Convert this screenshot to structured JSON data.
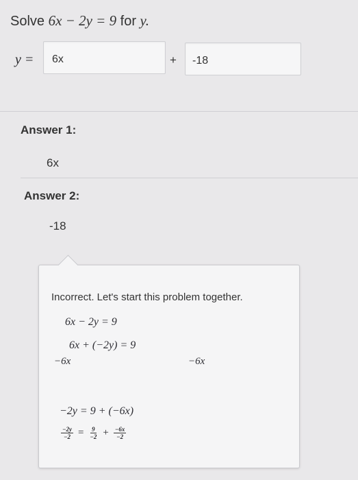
{
  "question": {
    "prefix": "Solve",
    "equation": "6x − 2y = 9",
    "suffix": "for",
    "variable": "y."
  },
  "input_row": {
    "y_label": "y =",
    "field1_value": "6x",
    "plus": "+",
    "field2_value": "-18"
  },
  "answers": [
    {
      "label": "Answer 1:",
      "value": "6x"
    },
    {
      "label": "Answer 2:",
      "value": "-18"
    }
  ],
  "feedback": {
    "title": "Incorrect. Let's start this problem together.",
    "steps": {
      "eq1": "6x − 2y = 9",
      "eq2": "6x + (−2y) = 9",
      "eq3": "−6x",
      "eq4": "−6x",
      "eq5": "−2y = 9 + (−6x)",
      "frac1_num": "−2y",
      "frac1_den": "−2",
      "equals": "=",
      "frac2_num": "9",
      "frac2_den": "−2",
      "plus": "+",
      "frac3_num": "−6x",
      "frac3_den": "−2"
    }
  }
}
